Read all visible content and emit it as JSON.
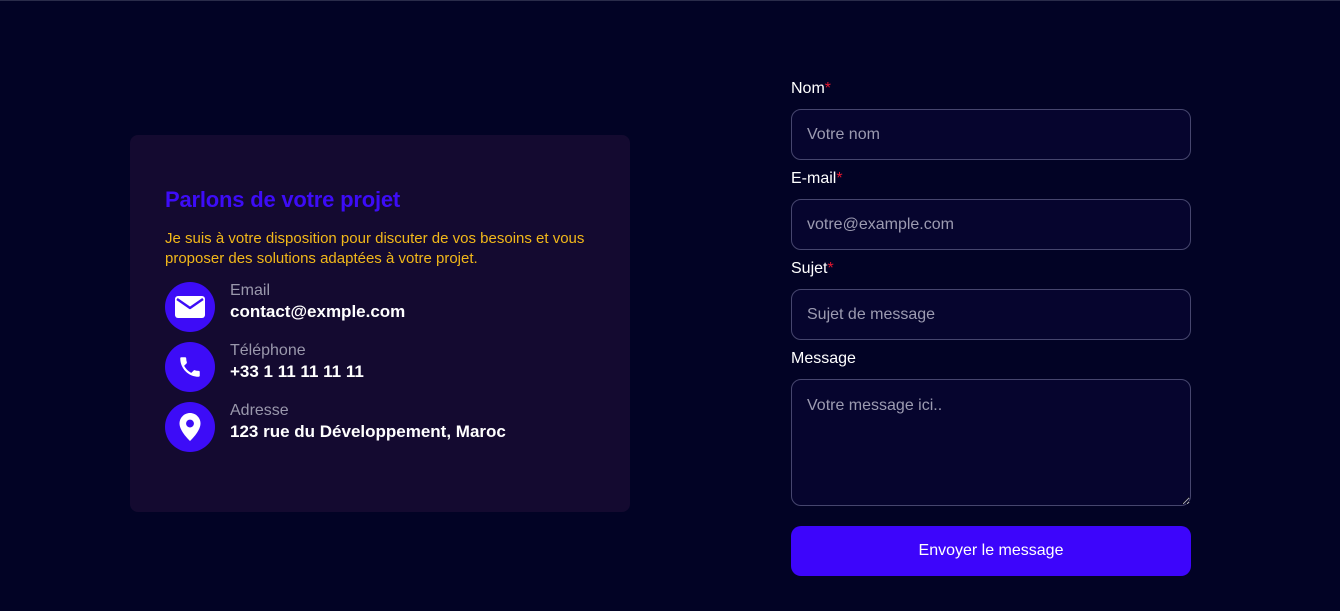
{
  "info": {
    "title": "Parlons de votre projet",
    "description": "Je suis à votre disposition pour discuter de vos besoins et vous proposer des solutions adaptées à votre projet.",
    "contacts": [
      {
        "icon": "envelope-icon",
        "label": "Email",
        "value": "contact@exmple.com"
      },
      {
        "icon": "phone-icon",
        "label": "Téléphone",
        "value": "+33 1 11 11 11 11"
      },
      {
        "icon": "map-pin-icon",
        "label": "Adresse",
        "value": "123 rue du Développement, Maroc"
      }
    ]
  },
  "form": {
    "name": {
      "label": "Nom",
      "required_mark": "*",
      "placeholder": "Votre nom",
      "value": ""
    },
    "email": {
      "label": "E-mail",
      "required_mark": "*",
      "placeholder": "votre@example.com",
      "value": ""
    },
    "subject": {
      "label": "Sujet",
      "required_mark": "*",
      "placeholder": "Sujet de message",
      "value": ""
    },
    "message": {
      "label": "Message",
      "placeholder": "Votre message ici..",
      "value": ""
    },
    "submit_label": "Envoyer le message"
  },
  "colors": {
    "background": "#020325",
    "card": "#140a30",
    "accent": "#3d0cf7",
    "description": "#f2b81a",
    "required": "#e5172f"
  }
}
